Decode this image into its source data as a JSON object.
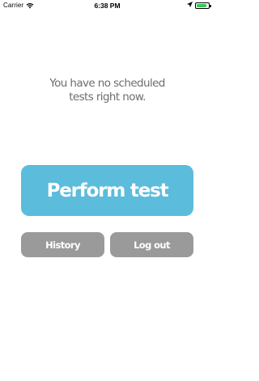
{
  "status_bar": {
    "carrier": "Carrier",
    "time": "6:38 PM",
    "icons": {
      "wifi": "wifi-icon",
      "location": "location-arrow-icon",
      "battery": "battery-icon"
    },
    "battery_color": "#36c759"
  },
  "main": {
    "message": "You have no scheduled\ntests right now."
  },
  "buttons": {
    "perform_test": "Perform test",
    "history": "History",
    "log_out": "Log out"
  },
  "colors": {
    "primary": "#5bbcdc",
    "secondary": "#9a9a9a",
    "message_text": "#6d6d6d"
  }
}
